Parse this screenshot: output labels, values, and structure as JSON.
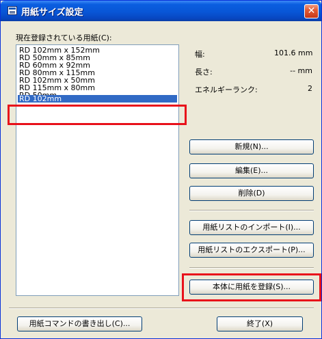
{
  "window": {
    "title": "用紙サイズ設定",
    "close_glyph": "✕"
  },
  "list_label": "現在登録されている用紙(C):",
  "paper_list": [
    "RD 102mm x 152mm",
    "RD 50mm x 85mm",
    "RD 60mm x 92mm",
    "RD 80mm x 115mm",
    "RD 102mm x 50mm",
    "RD 115mm x 80mm",
    "RD 50mm",
    "RD 102mm"
  ],
  "selected_item": "RD 102mm",
  "info": {
    "width_label": "幅:",
    "width_value": "101.6 mm",
    "length_label": "長さ:",
    "length_value": "-- mm",
    "energy_label": "エネルギーランク:",
    "energy_value": "2"
  },
  "buttons": {
    "new": "新規(N)...",
    "edit": "編集(E)...",
    "delete": "削除(D)",
    "import": "用紙リストのインポート(I)...",
    "export": "用紙リストのエクスポート(P)...",
    "register": "本体に用紙を登録(S)...",
    "write_command": "用紙コマンドの書き出し(C)...",
    "exit": "終了(X)"
  },
  "colors": {
    "titlebar": "#0856d6",
    "selection": "#316ac5",
    "highlight": "#e8101a",
    "dialog_bg": "#ece9d8"
  }
}
